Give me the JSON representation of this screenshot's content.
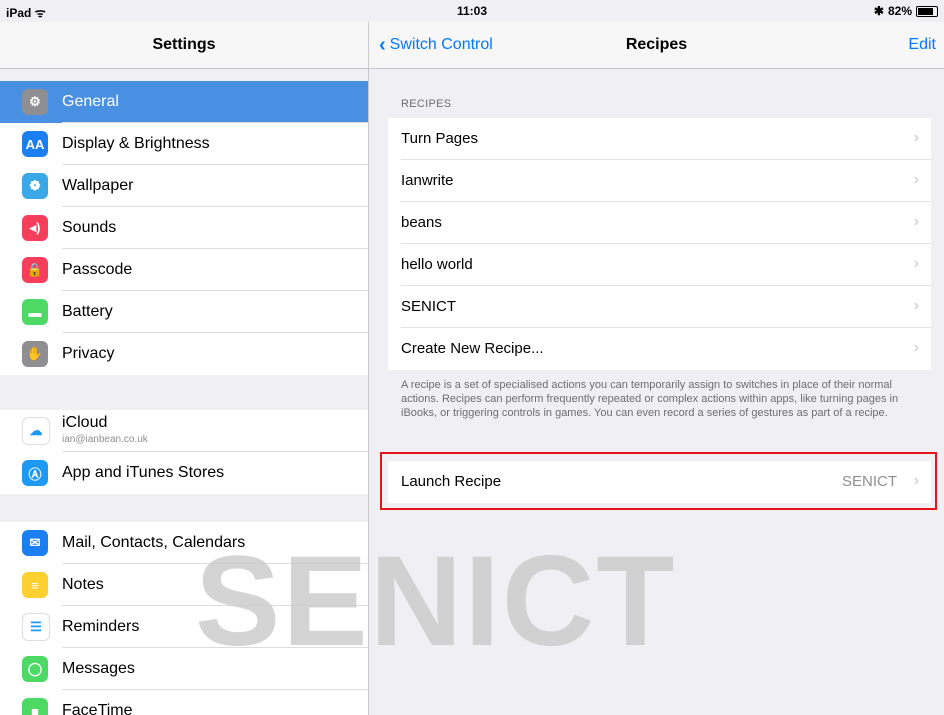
{
  "status": {
    "device": "iPad",
    "wifi_icon": "wifi-icon",
    "time": "11:03",
    "bluetooth_icon": "bluetooth-icon",
    "battery": "82%",
    "battery_fraction": 0.82
  },
  "left": {
    "title": "Settings",
    "group1": [
      {
        "label": "General",
        "icon": "gear-icon",
        "color": "#8e8e93",
        "glyph": "⚙",
        "selected": true
      },
      {
        "label": "Display & Brightness",
        "icon": "text-size-icon",
        "color": "#1c7ff1",
        "glyph": "AA"
      },
      {
        "label": "Wallpaper",
        "icon": "flower-icon",
        "color": "#3aa8e6",
        "glyph": "❁"
      },
      {
        "label": "Sounds",
        "icon": "speaker-icon",
        "color": "#f53d5c",
        "glyph": "◂)"
      },
      {
        "label": "Passcode",
        "icon": "lock-icon",
        "color": "#f53d5c",
        "glyph": "🔒"
      },
      {
        "label": "Battery",
        "icon": "battery-icon",
        "color": "#4cd964",
        "glyph": "▬"
      },
      {
        "label": "Privacy",
        "icon": "hand-icon",
        "color": "#8e8e93",
        "glyph": "✋"
      }
    ],
    "group2": [
      {
        "label": "iCloud",
        "sub": "ian@ianbean.co.uk",
        "icon": "cloud-icon",
        "color": "#ffffff",
        "glyph": "☁"
      },
      {
        "label": "App and iTunes Stores",
        "icon": "app-store-icon",
        "color": "#1c9af5",
        "glyph": "Ⓐ"
      }
    ],
    "group3": [
      {
        "label": "Mail, Contacts, Calendars",
        "icon": "mail-icon",
        "color": "#1c7ff1",
        "glyph": "✉"
      },
      {
        "label": "Notes",
        "icon": "notes-icon",
        "color": "#fcd02f",
        "glyph": "≡"
      },
      {
        "label": "Reminders",
        "icon": "reminders-icon",
        "color": "#ffffff",
        "glyph": "☰"
      },
      {
        "label": "Messages",
        "icon": "messages-icon",
        "color": "#4cd964",
        "glyph": "◯"
      },
      {
        "label": "FaceTime",
        "icon": "facetime-icon",
        "color": "#4cd964",
        "glyph": "■"
      }
    ]
  },
  "right": {
    "back_label": "Switch Control",
    "title": "Recipes",
    "edit_label": "Edit",
    "section_header": "RECIPES",
    "recipes": [
      "Turn Pages",
      "Ianwrite",
      "beans",
      "hello world",
      "SENICT",
      "Create New Recipe..."
    ],
    "footer": "A recipe is a set of specialised actions you can temporarily assign to switches in place of their normal actions. Recipes can perform frequently repeated or complex actions within apps, like turning pages in iBooks, or triggering controls in games. You can even record a series of gestures as part of a recipe.",
    "launch": {
      "label": "Launch Recipe",
      "value": "SENICT"
    }
  },
  "watermark": "SENICT"
}
